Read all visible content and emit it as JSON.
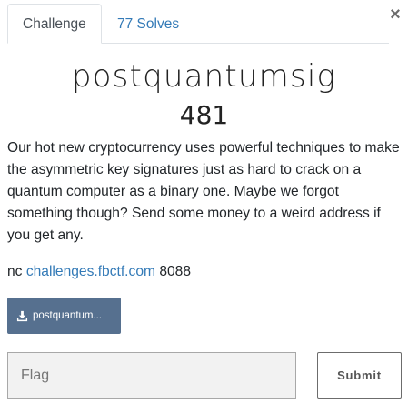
{
  "modal": {
    "close_symbol": "×"
  },
  "tabs": [
    {
      "label": "Challenge",
      "active": true
    },
    {
      "label": "77 Solves",
      "active": false
    }
  ],
  "challenge": {
    "name": "postquantumsig",
    "value": "481",
    "description": "Our hot new cryptocurrency uses powerful techniques to make the asymmetric key signatures just as hard to crack on a quantum computer as a binary one. Maybe we forgot something though? Send some money to a weird address if you get any.",
    "connection": {
      "prefix": "nc",
      "host": "challenges.fbctf.com",
      "port": "8088"
    },
    "file": {
      "icon": "download-icon",
      "label": "postquantumsig.tar.gz",
      "display": "postquantum..."
    }
  },
  "form": {
    "flag_placeholder": "Flag",
    "flag_value": "",
    "submit_label": "Submit"
  },
  "colors": {
    "link": "#337ab7",
    "file_button": "#56708f",
    "input_bg": "#f2f2f2"
  }
}
